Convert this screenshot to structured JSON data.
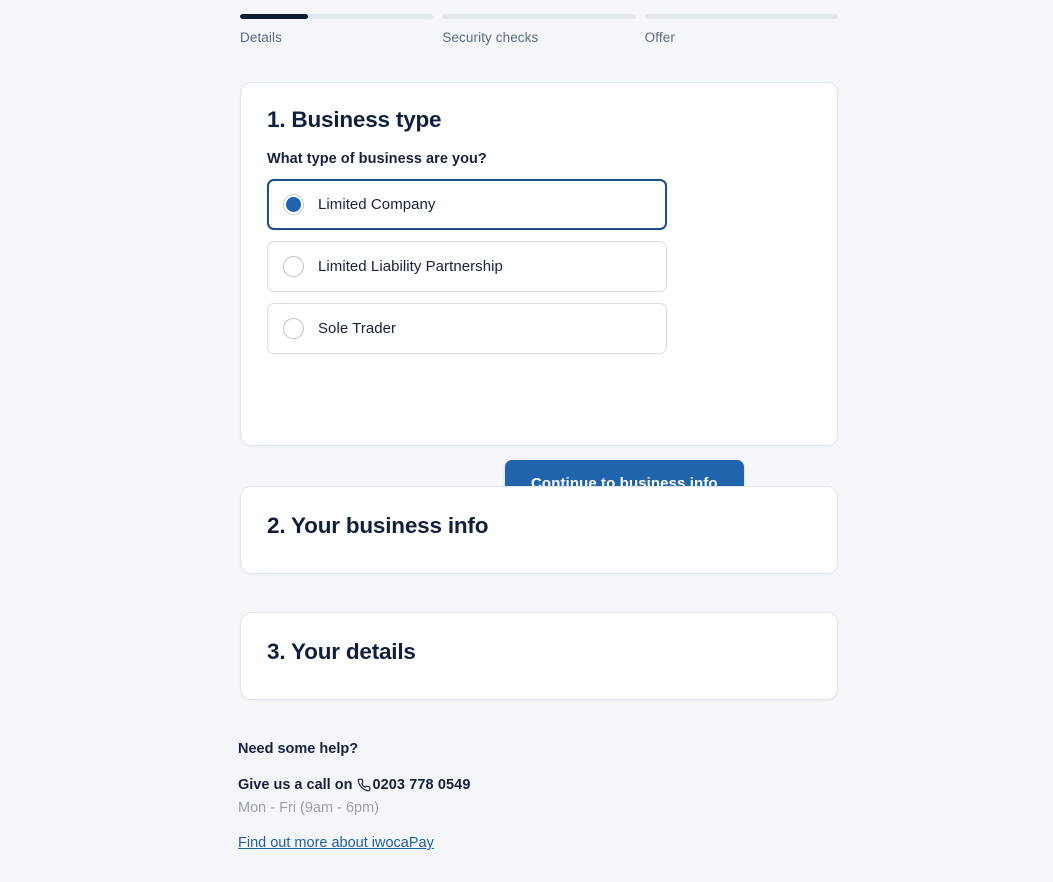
{
  "stepper": {
    "steps": [
      {
        "label": "Details",
        "progress_percent": 35
      },
      {
        "label": "Security checks",
        "progress_percent": 0
      },
      {
        "label": "Offer",
        "progress_percent": 0
      }
    ],
    "active_color": "#0d1b33",
    "track_color": "#e3e8ee",
    "label_color": "#5a6c85"
  },
  "sections": {
    "business_type": {
      "title": "1. Business type",
      "question": "What type of business are you?",
      "options": [
        {
          "label": "Limited Company",
          "selected": true
        },
        {
          "label": "Limited Liability Partnership",
          "selected": false
        },
        {
          "label": "Sole Trader",
          "selected": false
        }
      ],
      "continue_label": "Continue to business info",
      "accent_color": "#2164ae",
      "selected_border_color": "#1b4f85"
    },
    "business_info": {
      "title": "2. Your business info"
    },
    "your_details": {
      "title": "3. Your details"
    }
  },
  "help": {
    "title": "Need some help?",
    "call_prefix": "Give us a call on",
    "phone_icon": "phone-icon",
    "phone": "0203 778 0549",
    "hours": "Mon - Fri (9am - 6pm)",
    "link": "Find out more about iwocaPay",
    "link_color": "#1f5fa9",
    "hours_color": "#9aa1ab"
  }
}
